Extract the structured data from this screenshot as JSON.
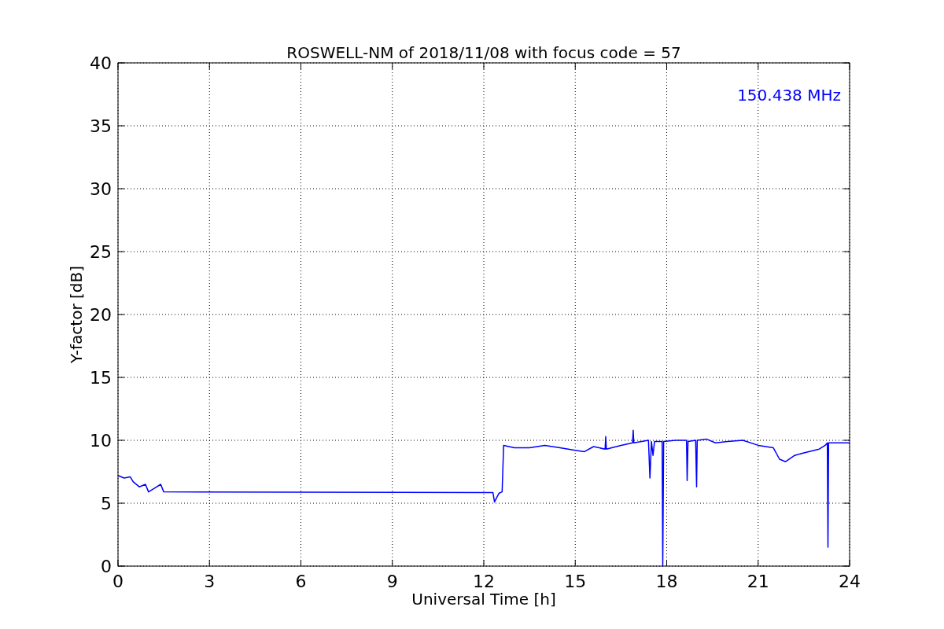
{
  "chart_data": {
    "type": "line",
    "title": "ROSWELL-NM of 2018/11/08 with focus code = 57",
    "xlabel": "Universal Time [h]",
    "ylabel": "Y-factor [dB]",
    "x": [
      0,
      0.2,
      0.4,
      0.5,
      0.7,
      0.9,
      1.0,
      1.2,
      1.4,
      1.5,
      12.3,
      12.35,
      12.5,
      12.6,
      12.65,
      13,
      13.5,
      14,
      14.5,
      15,
      15.3,
      15.6,
      15.98,
      16.0,
      16.02,
      16.5,
      16.88,
      16.9,
      16.92,
      17.4,
      17.45,
      17.5,
      17.55,
      17.6,
      17.85,
      17.87,
      17.9,
      18.3,
      18.65,
      18.67,
      18.7,
      18.95,
      18.98,
      19.0,
      19.3,
      19.6,
      20,
      20.5,
      21,
      21.5,
      21.7,
      21.9,
      22.2,
      22.5,
      23,
      23.2,
      23.27,
      23.29,
      23.31,
      23.5,
      24
    ],
    "series": [
      {
        "name": "150.438 MHz",
        "color": "#0000ff",
        "values": [
          7.2,
          7.0,
          7.1,
          6.7,
          6.3,
          6.5,
          5.9,
          6.2,
          6.5,
          5.9,
          5.85,
          5.1,
          5.8,
          5.9,
          9.6,
          9.4,
          9.4,
          9.6,
          9.4,
          9.2,
          9.1,
          9.5,
          9.3,
          10.3,
          9.3,
          9.6,
          9.8,
          10.8,
          9.8,
          10.0,
          7.0,
          9.9,
          8.8,
          9.9,
          9.9,
          0,
          9.9,
          10.0,
          10.0,
          6.8,
          9.9,
          10.0,
          6.3,
          10.0,
          10.1,
          9.8,
          9.9,
          10.0,
          9.6,
          9.4,
          8.5,
          8.3,
          8.8,
          9.0,
          9.3,
          9.6,
          9.8,
          1.5,
          9.8,
          9.8,
          9.8
        ]
      }
    ],
    "grid": true,
    "xlim": [
      0,
      24
    ],
    "ylim": [
      0,
      40
    ],
    "xticks": [
      0,
      3,
      6,
      9,
      12,
      15,
      18,
      21,
      24
    ],
    "yticks": [
      0,
      5,
      10,
      15,
      20,
      25,
      30,
      35,
      40
    ]
  }
}
